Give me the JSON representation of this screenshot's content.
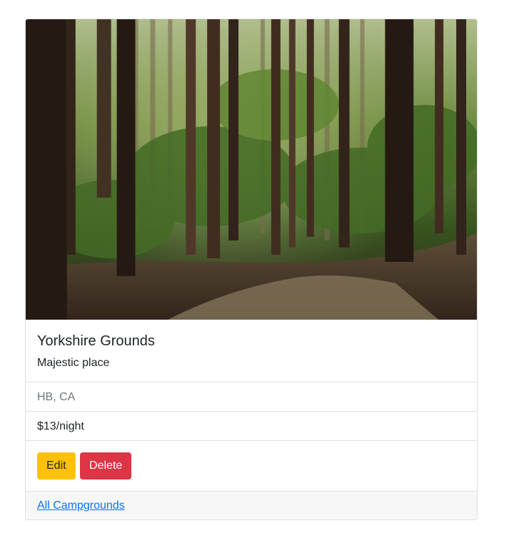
{
  "campground": {
    "image_alt": "Forest path campground photo",
    "title": "Yorkshire Grounds",
    "description": "Majestic place",
    "location": "HB, CA",
    "price": "$13/night"
  },
  "actions": {
    "edit_label": "Edit",
    "delete_label": "Delete"
  },
  "footer": {
    "link_label": "All Campgrounds"
  },
  "colors": {
    "edit_button": "#ffc107",
    "delete_button": "#dc3545",
    "link": "#0d6efd",
    "footer_bg": "#f7f7f7"
  }
}
